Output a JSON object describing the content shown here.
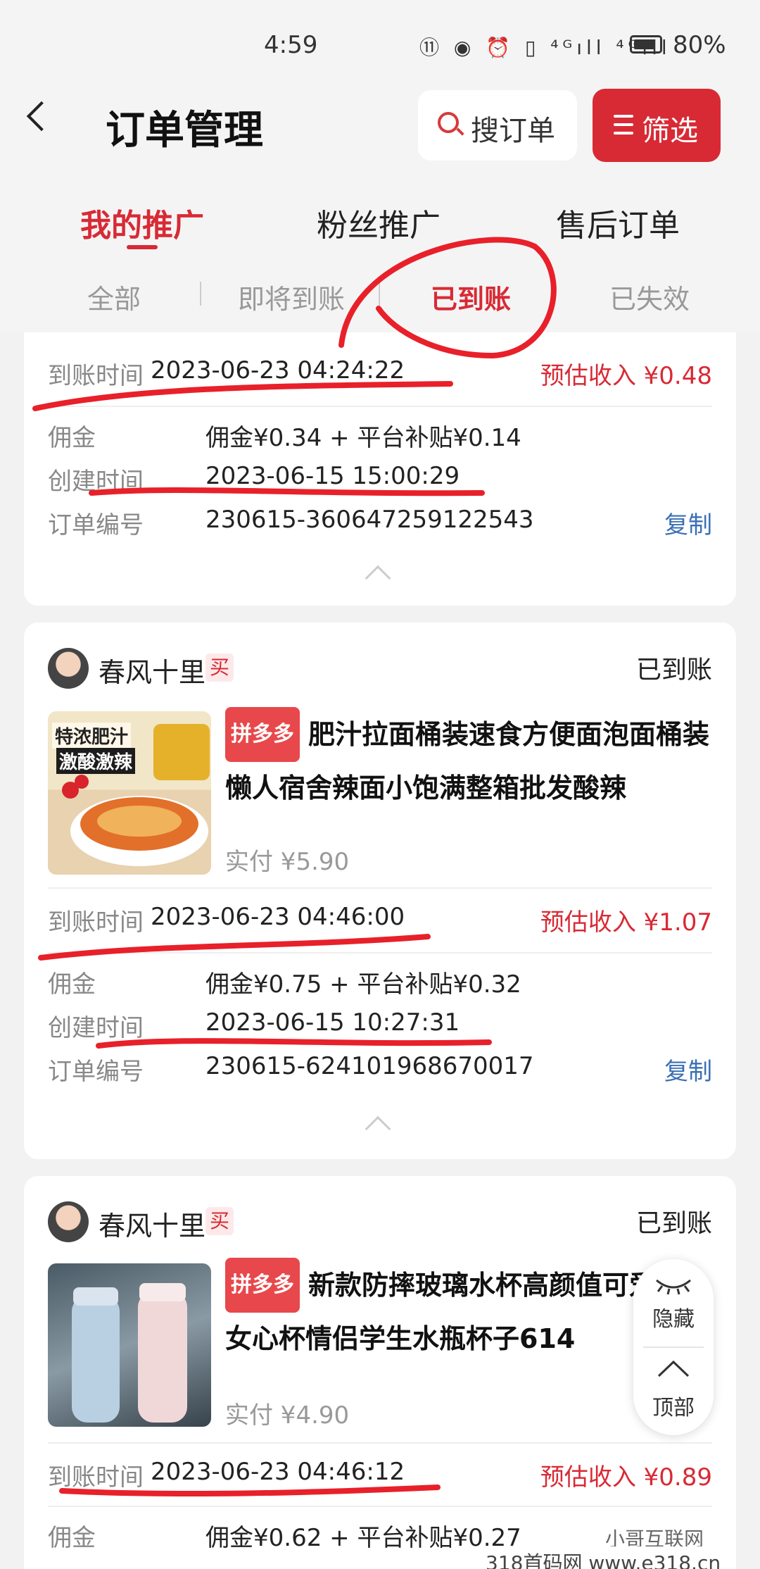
{
  "status_bar": {
    "time": "4:59",
    "icons": "⑪ ◉ ⏰ ▯ ⁴ᴳıll ⁴ᴳıll",
    "battery": "80%"
  },
  "header": {
    "title": "订单管理",
    "search_label": "搜订单",
    "filter_label": "筛选"
  },
  "tabs": [
    "我的推广",
    "粉丝推广",
    "售后订单"
  ],
  "subtabs": [
    "全部",
    "即将到账",
    "已到账",
    "已失效"
  ],
  "orders": [
    {
      "arrival_label": "到账时间",
      "arrival_time": "2023-06-23 04:24:22",
      "income": "预估收入 ¥0.48",
      "commission_label": "佣金",
      "commission": "佣金¥0.34 + 平台补贴¥0.14",
      "created_label": "创建时间",
      "created": "2023-06-15 15:00:29",
      "order_label": "订单编号",
      "order_no": "230615-360647259122543",
      "copy": "复制"
    },
    {
      "user": "春风十里",
      "buy_tag": "买",
      "status": "已到账",
      "platform": "拼多多",
      "product": "肥汁拉面桶装速食方便面泡面桶装懒人宿舍辣面小饱满整箱批发酸辣",
      "thumb_text1": "特浓肥汁",
      "thumb_text2": "激酸激辣",
      "paid": "实付 ¥5.90",
      "arrival_label": "到账时间",
      "arrival_time": "2023-06-23 04:46:00",
      "income": "预估收入 ¥1.07",
      "commission_label": "佣金",
      "commission": "佣金¥0.75 + 平台补贴¥0.32",
      "created_label": "创建时间",
      "created": "2023-06-15 10:27:31",
      "order_label": "订单编号",
      "order_no": "230615-624101968670017",
      "copy": "复制"
    },
    {
      "user": "春风十里",
      "buy_tag": "买",
      "status": "已到账",
      "platform": "拼多多",
      "product": "新款防摔玻璃水杯高颜值可爱女心杯情侣学生水瓶杯子614",
      "paid": "实付 ¥4.90",
      "arrival_label": "到账时间",
      "arrival_time": "2023-06-23 04:46:12",
      "income": "预估收入 ¥0.89",
      "commission_label": "佣金",
      "commission": "佣金¥0.62 + 平台补贴¥0.27"
    }
  ],
  "float": {
    "hide": "隐藏",
    "top": "顶部"
  },
  "watermark": {
    "account": "小哥互联网",
    "site": "318首码网 www.e318.cn"
  },
  "colors": {
    "accent": "#d82a35",
    "link": "#3a6fb5",
    "annotation": "#e8202a"
  }
}
